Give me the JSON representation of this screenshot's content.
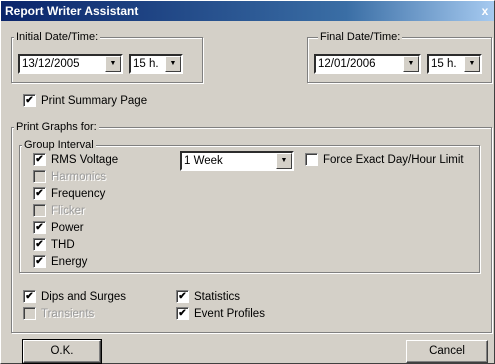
{
  "window": {
    "title": "Report Writer Assistant",
    "close_glyph": "x"
  },
  "initial": {
    "legend": "Initial Date/Time:",
    "date": "13/12/2005",
    "hour": "15 h."
  },
  "final": {
    "legend": "Final Date/Time:",
    "date": "12/01/2006",
    "hour": "15 h."
  },
  "summary": {
    "label": "Print Summary Page",
    "checked": true
  },
  "graphs": {
    "legend": "Print Graphs for:",
    "group_legend": "Group Interval",
    "interval": "1 Week",
    "force_label": "Force Exact Day/Hour Limit",
    "items": [
      {
        "label": "RMS Voltage",
        "checked": true,
        "enabled": true
      },
      {
        "label": "Harmonics",
        "checked": false,
        "enabled": false
      },
      {
        "label": "Frequency",
        "checked": true,
        "enabled": true
      },
      {
        "label": "Flicker",
        "checked": false,
        "enabled": false
      },
      {
        "label": "Power",
        "checked": true,
        "enabled": true
      },
      {
        "label": "THD",
        "checked": true,
        "enabled": true
      },
      {
        "label": "Energy",
        "checked": true,
        "enabled": true
      }
    ],
    "extra": [
      {
        "label": "Dips and Surges",
        "checked": true,
        "enabled": true
      },
      {
        "label": "Transients",
        "checked": false,
        "enabled": false
      },
      {
        "label": "Statistics",
        "checked": true,
        "enabled": true
      },
      {
        "label": "Event Profiles",
        "checked": true,
        "enabled": true
      }
    ]
  },
  "buttons": {
    "ok": "O.K.",
    "cancel": "Cancel"
  },
  "glyphs": {
    "check": "✔",
    "dropdown": "▼"
  }
}
